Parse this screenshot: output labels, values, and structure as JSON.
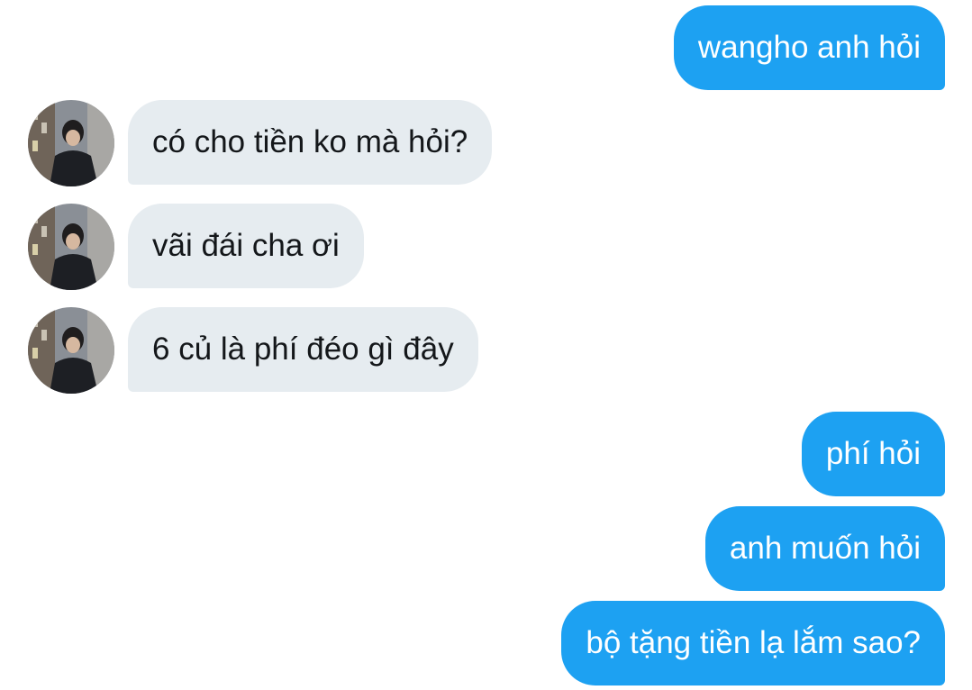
{
  "conversation": {
    "messages": [
      {
        "direction": "sent",
        "text": "wangho anh hỏi"
      },
      {
        "direction": "received",
        "text": "có cho tiền ko mà hỏi?"
      },
      {
        "direction": "received",
        "text": "vãi đái cha ơi"
      },
      {
        "direction": "received",
        "text": "6 củ là phí đéo gì đây"
      },
      {
        "direction": "sent",
        "text": "phí hỏi"
      },
      {
        "direction": "sent",
        "text": "anh muốn hỏi"
      },
      {
        "direction": "sent",
        "text": "bộ tặng tiền lạ lắm sao?"
      }
    ]
  },
  "colors": {
    "sent_bubble": "#1da1f2",
    "sent_text": "#ffffff",
    "received_bubble": "#e6ecf0",
    "received_text": "#14171a",
    "background": "#ffffff"
  },
  "icons": {
    "contact_avatar": "user-avatar-photo"
  }
}
